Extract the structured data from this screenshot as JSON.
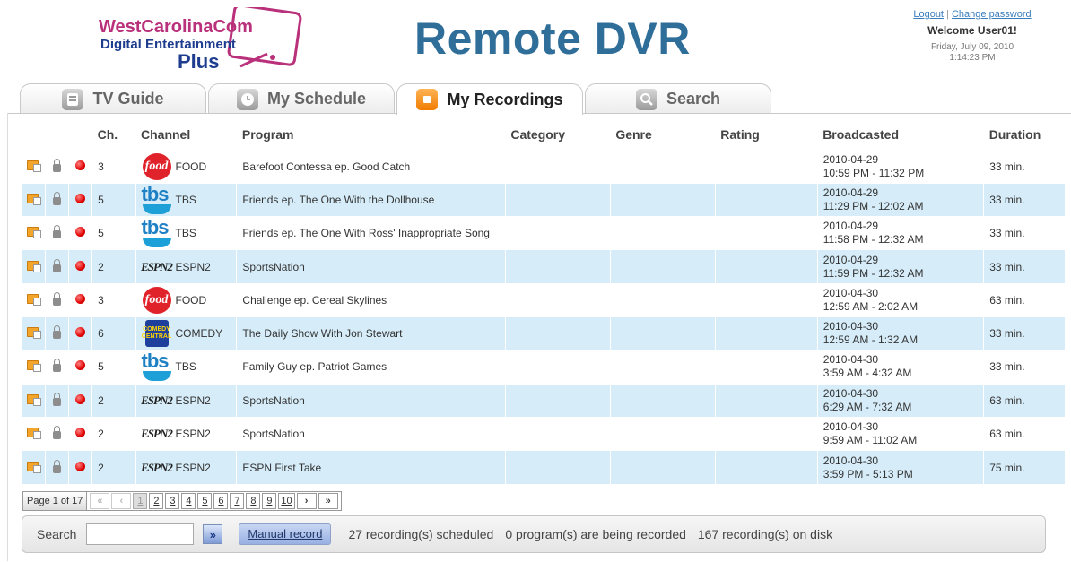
{
  "header": {
    "logo": {
      "line1": "WestCarolinaCom",
      "line2": "Digital Entertainment",
      "line3": "Plus"
    },
    "title": "Remote DVR",
    "logout_label": "Logout",
    "link_separator": "|",
    "change_password_label": "Change password",
    "welcome": "Welcome User01!",
    "date": "Friday, July 09, 2010",
    "time": "1:14:23 PM"
  },
  "tabs": [
    {
      "label": "TV Guide",
      "icon": "tv-guide-icon",
      "active": false
    },
    {
      "label": "My Schedule",
      "icon": "clock-icon",
      "active": false
    },
    {
      "label": "My Recordings",
      "icon": "record-icon",
      "active": true
    },
    {
      "label": "Search",
      "icon": "search-icon",
      "active": false
    }
  ],
  "table": {
    "headers": {
      "ch": "Ch.",
      "channel": "Channel",
      "program": "Program",
      "category": "Category",
      "genre": "Genre",
      "rating": "Rating",
      "broadcasted": "Broadcasted",
      "duration": "Duration"
    },
    "rows": [
      {
        "ch": "3",
        "logo": "food",
        "channel": "FOOD",
        "program": "Barefoot Contessa ep. Good Catch",
        "category": "",
        "genre": "",
        "rating": "",
        "date": "2010-04-29",
        "time": "10:59 PM - 11:32 PM",
        "duration": "33 min."
      },
      {
        "ch": "5",
        "logo": "tbs",
        "channel": "TBS",
        "program": "Friends ep. The One With the Dollhouse",
        "category": "",
        "genre": "",
        "rating": "",
        "date": "2010-04-29",
        "time": "11:29 PM - 12:02 AM",
        "duration": "33 min."
      },
      {
        "ch": "5",
        "logo": "tbs",
        "channel": "TBS",
        "program": "Friends ep. The One With Ross' Inappropriate Song",
        "category": "",
        "genre": "",
        "rating": "",
        "date": "2010-04-29",
        "time": "11:58 PM - 12:32 AM",
        "duration": "33 min."
      },
      {
        "ch": "2",
        "logo": "espn2",
        "channel": "ESPN2",
        "program": "SportsNation",
        "category": "",
        "genre": "",
        "rating": "",
        "date": "2010-04-29",
        "time": "11:59 PM - 12:32 AM",
        "duration": "33 min."
      },
      {
        "ch": "3",
        "logo": "food",
        "channel": "FOOD",
        "program": "Challenge ep. Cereal Skylines",
        "category": "",
        "genre": "",
        "rating": "",
        "date": "2010-04-30",
        "time": "12:59 AM - 2:02 AM",
        "duration": "63 min."
      },
      {
        "ch": "6",
        "logo": "comedy",
        "channel": "COMEDY",
        "program": "The Daily Show With Jon Stewart",
        "category": "",
        "genre": "",
        "rating": "",
        "date": "2010-04-30",
        "time": "12:59 AM - 1:32 AM",
        "duration": "33 min."
      },
      {
        "ch": "5",
        "logo": "tbs",
        "channel": "TBS",
        "program": "Family Guy ep. Patriot Games",
        "category": "",
        "genre": "",
        "rating": "",
        "date": "2010-04-30",
        "time": "3:59 AM - 4:32 AM",
        "duration": "33 min."
      },
      {
        "ch": "2",
        "logo": "espn2",
        "channel": "ESPN2",
        "program": "SportsNation",
        "category": "",
        "genre": "",
        "rating": "",
        "date": "2010-04-30",
        "time": "6:29 AM - 7:32 AM",
        "duration": "63 min."
      },
      {
        "ch": "2",
        "logo": "espn2",
        "channel": "ESPN2",
        "program": "SportsNation",
        "category": "",
        "genre": "",
        "rating": "",
        "date": "2010-04-30",
        "time": "9:59 AM - 11:02 AM",
        "duration": "63 min."
      },
      {
        "ch": "2",
        "logo": "espn2",
        "channel": "ESPN2",
        "program": "ESPN First Take",
        "category": "",
        "genre": "",
        "rating": "",
        "date": "2010-04-30",
        "time": "3:59 PM - 5:13 PM",
        "duration": "75 min."
      }
    ]
  },
  "logo_text": {
    "food": "food",
    "tbs": "tbs",
    "espn2": "ESPN2",
    "comedy": "COMEDY CENTRAL"
  },
  "pager": {
    "label": "Page 1 of 17",
    "first": "«",
    "prev": "‹",
    "pages": [
      "1",
      "2",
      "3",
      "4",
      "5",
      "6",
      "7",
      "8",
      "9",
      "10"
    ],
    "current": "1",
    "next": "›",
    "last": "»"
  },
  "bottom": {
    "search_label": "Search",
    "search_value": "",
    "go_label": "»",
    "manual_record_label": "Manual record",
    "scheduled": "27 recording(s) scheduled",
    "being_recorded": "0 program(s) are being recorded",
    "on_disk": "167 recording(s) on disk"
  },
  "colors": {
    "title": "#2f6e99",
    "alt_row": "#d6edf9",
    "tab_active_icon": "#f07b00",
    "link": "#3a7dbc"
  }
}
